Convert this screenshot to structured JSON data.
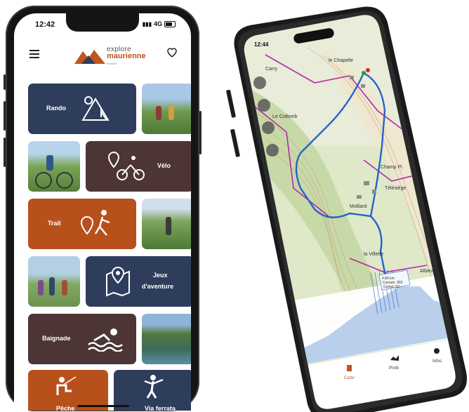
{
  "left_phone": {
    "status": {
      "time": "12:42",
      "network": "4G"
    },
    "header": {
      "logo_line1": "explore",
      "logo_line2": "maurienne",
      "logo_tagline": "territoire",
      "menu_icon": "hamburger-menu-icon",
      "favorites_icon": "heart-icon"
    },
    "tiles": [
      {
        "label": "Rando",
        "icon": "hiking-icon",
        "color": "#2f3d5c"
      },
      {
        "label": "Vélo",
        "icon": "cycling-icon",
        "color": "#4d3535"
      },
      {
        "label": "Trail",
        "icon": "trail-running-icon",
        "color": "#b8501c"
      },
      {
        "label": "Jeux",
        "label2": "d'aventure",
        "icon": "map-pin-icon",
        "color": "#2f3d5c"
      },
      {
        "label": "Baignade",
        "icon": "swimming-icon",
        "color": "#4d3535"
      },
      {
        "label": "Pêche",
        "icon": "fishing-icon",
        "color": "#b8501c"
      },
      {
        "label": "Via ferrata",
        "icon": "via-ferrata-icon",
        "color": "#2f3d5c"
      }
    ]
  },
  "right_phone": {
    "status": {
      "time": "12:44"
    },
    "map": {
      "places": [
        "Le Collomb",
        "Champ Pi",
        "Molliard",
        "la Villette",
        "Télésiège",
        "Carry",
        "le Chapelle",
        "Albiez"
      ]
    },
    "profile_tooltip": {
      "line1": "4.86 km",
      "line2": "Cumule: 303",
      "line3": "Cumul: 52"
    },
    "tabs": [
      {
        "label": "Carte",
        "icon": "map-tab-icon",
        "active": true
      },
      {
        "label": "Profil",
        "icon": "profile-tab-icon",
        "active": false
      },
      {
        "label": "Infos",
        "icon": "info-tab-icon",
        "active": false
      }
    ],
    "accent_color": "#c0551f"
  }
}
